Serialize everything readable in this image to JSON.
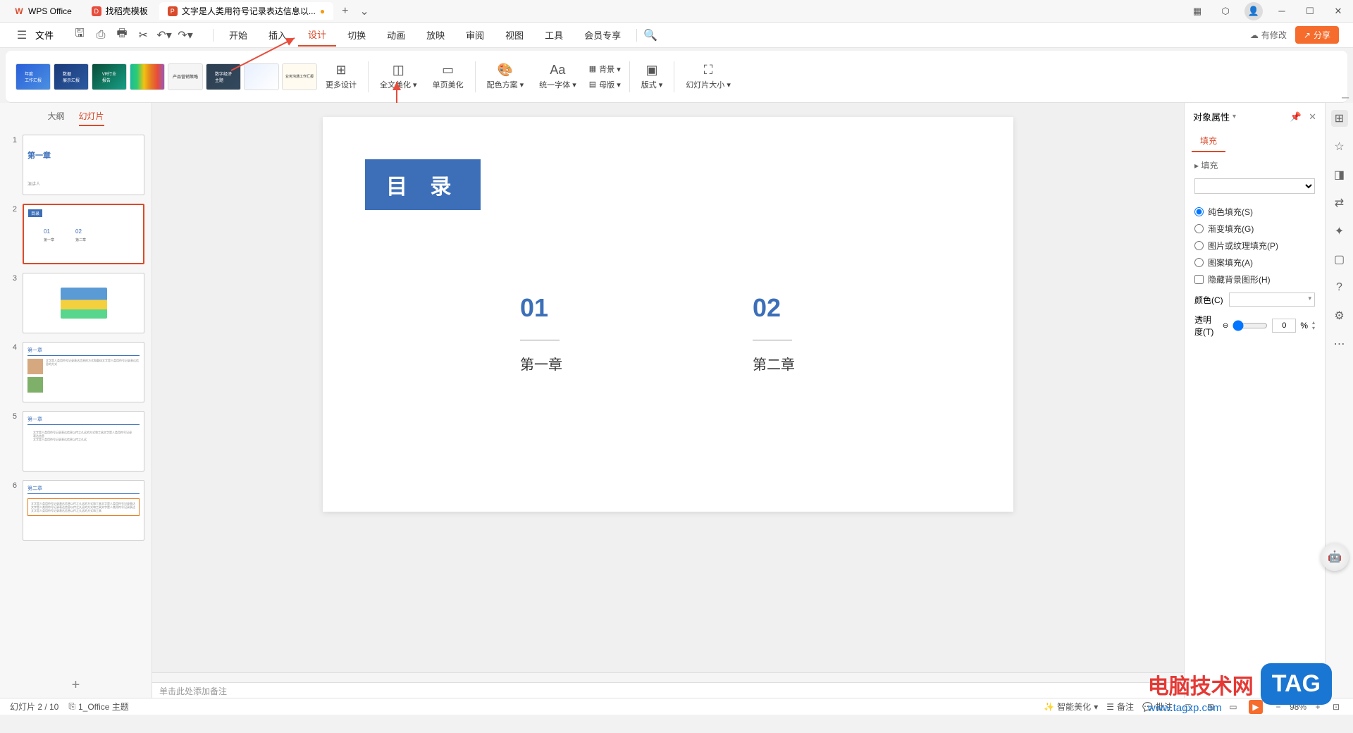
{
  "titlebar": {
    "tabs": [
      {
        "icon": "W",
        "iconColor": "#d94b2b",
        "label": "WPS Office"
      },
      {
        "icon": "D",
        "iconColor": "#e74c3c",
        "label": "找稻壳模板"
      },
      {
        "icon": "P",
        "iconColor": "#d94b2b",
        "label": "文字是人类用符号记录表达信息以..."
      }
    ],
    "addLabel": "+",
    "dropdown": "⌄"
  },
  "menubar": {
    "fileLabel": "文件",
    "items": [
      "开始",
      "插入",
      "设计",
      "切换",
      "动画",
      "放映",
      "审阅",
      "视图",
      "工具",
      "会员专享"
    ],
    "activeIndex": 2,
    "cloudStatus": "有修改",
    "shareLabel": "分享"
  },
  "ribbon": {
    "buttons": [
      {
        "label": "更多设计",
        "icon": "⊞"
      },
      {
        "label": "全文美化",
        "icon": "◫",
        "dropdown": true
      },
      {
        "label": "单页美化",
        "icon": "▭"
      }
    ],
    "group2": [
      {
        "label": "配色方案",
        "icon": "🎨",
        "dropdown": true
      },
      {
        "label": "统一字体",
        "icon": "Aa",
        "dropdown": true
      }
    ],
    "group2b": [
      {
        "label": "背景",
        "icon": "▦",
        "dropdown": true
      },
      {
        "label": "母版",
        "icon": "▤",
        "dropdown": true
      }
    ],
    "group3": [
      {
        "label": "版式",
        "icon": "▣",
        "dropdown": true
      }
    ],
    "group4": [
      {
        "label": "幻灯片大小",
        "icon": "⛶",
        "dropdown": true
      }
    ]
  },
  "slidePanel": {
    "tabs": [
      "大纲",
      "幻灯片"
    ],
    "activeTab": 1,
    "slideCount": 6,
    "selectedIndex": 1,
    "slide1Title": "第一章",
    "slide1Sub": "演讲人",
    "slide2Title": "目录",
    "slide2Item1Num": "01",
    "slide2Item1Label": "第一章",
    "slide2Item2Num": "02",
    "slide2Item2Label": "第二章",
    "slide4Title": "第一章",
    "slide5Title": "第一章",
    "slide6Title": "第二章",
    "addIcon": "+"
  },
  "canvas": {
    "tocTitle": "目 录",
    "item1Num": "01",
    "item1Label": "第一章",
    "item2Num": "02",
    "item2Label": "第二章",
    "notesPlaceholder": "单击此处添加备注"
  },
  "propPanel": {
    "title": "对象属性",
    "tab": "填充",
    "sectionTitle": "▸ 填充",
    "options": [
      "纯色填充(S)",
      "渐变填充(G)",
      "图片或纹理填充(P)",
      "图案填充(A)"
    ],
    "selectedOption": 0,
    "hideBgLabel": "隐藏背景图形(H)",
    "colorLabel": "颜色(C)",
    "transparencyLabel": "透明度(T)",
    "transparencyValue": "0",
    "transparencyUnit": "%"
  },
  "statusbar": {
    "slideInfo": "幻灯片 2 / 10",
    "theme": "1_Office 主题",
    "ai": "智能美化",
    "notes": "备注",
    "comments": "批注",
    "zoom": "98%"
  },
  "watermark": {
    "text": "电脑技术网",
    "url": "www.tagxp.com",
    "tag": "TAG"
  }
}
